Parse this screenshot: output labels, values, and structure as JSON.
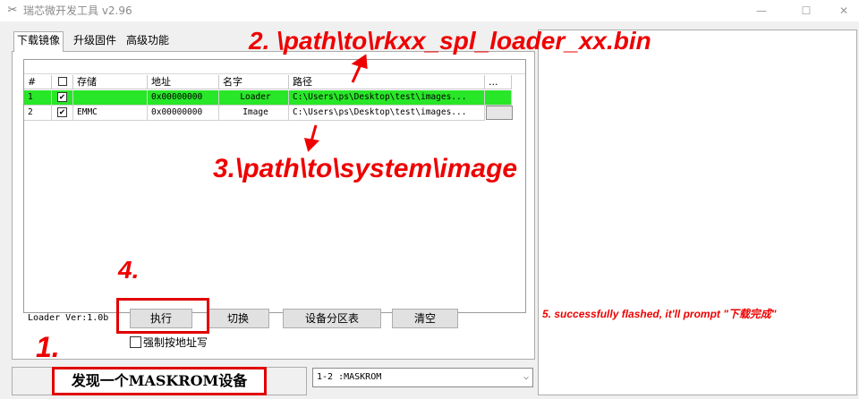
{
  "window": {
    "title": "瑞芯微开发工具 v2.96",
    "minimize_glyph": "—",
    "maximize_glyph": "☐",
    "close_glyph": "✕"
  },
  "tabs": [
    {
      "label": "下载镜像",
      "active": true
    },
    {
      "label": "升级固件",
      "active": false
    },
    {
      "label": "高级功能",
      "active": false
    }
  ],
  "table": {
    "columns": [
      "#",
      "",
      "存储",
      "地址",
      "名字",
      "路径",
      "..."
    ],
    "rows": [
      {
        "index": "1",
        "checked": true,
        "storage": "",
        "address": "0x00000000",
        "name": "Loader",
        "path": "C:\\Users\\ps\\Desktop\\test\\images...",
        "highlight": true
      },
      {
        "index": "2",
        "checked": true,
        "storage": "EMMC",
        "address": "0x00000000",
        "name": "Image",
        "path": "C:\\Users\\ps\\Desktop\\test\\images...",
        "highlight": false
      }
    ],
    "check_glyph": "✔",
    "row_highlight_color": "#28e628"
  },
  "controls": {
    "loader_version": "Loader Ver:1.0b",
    "run_button": "执行",
    "switch_button": "切换",
    "partition_button": "设备分区表",
    "clear_button": "清空",
    "force_address_checkbox": "强制按地址写"
  },
  "status": {
    "device_found": "发现一个MASKROM设备",
    "device_select": "1-2 :MASKROM",
    "select_arrow": "⌵"
  },
  "annotations": {
    "step1": "1.",
    "step2": "2. \\path\\to\\rkxx_spl_loader_xx.bin",
    "step3": "3.\\path\\to\\system\\image",
    "step4": "4.",
    "step5": "5. successfully flashed, it'll prompt \"下载完成\"",
    "color": "#ee0000"
  }
}
